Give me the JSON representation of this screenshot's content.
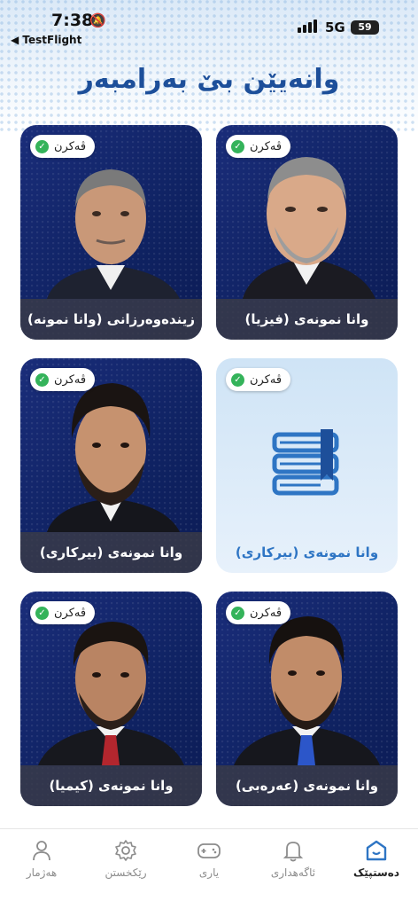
{
  "status_bar": {
    "time": "7:38",
    "back_label": "◀ TestFlight",
    "network": "5G",
    "battery": "59"
  },
  "page": {
    "title": "وانەیێن بێ بەرامبەر"
  },
  "cards": [
    {
      "badge": "ڤەکرن",
      "caption": "وانا نمونەی (فیزیا)",
      "style": "photo"
    },
    {
      "badge": "ڤەکرن",
      "caption": "زیندەوەرزانی (وانا نمونە)",
      "style": "photo"
    },
    {
      "badge": "ڤەکرن",
      "caption": "وانا نمونەی (بیرکاری)",
      "style": "book"
    },
    {
      "badge": "ڤەکرن",
      "caption": "وانا نمونەی (بیرکاری)",
      "style": "photo"
    },
    {
      "badge": "ڤەکرن",
      "caption": "وانا نمونەی (عەرەبی)",
      "style": "photo"
    },
    {
      "badge": "ڤەکرن",
      "caption": "وانا نمونەی (کیمیا)",
      "style": "photo"
    }
  ],
  "tabbar": {
    "items": [
      {
        "label": "دەستپێک",
        "icon": "home-icon",
        "active": true
      },
      {
        "label": "ئاگەهداری",
        "icon": "bell-icon",
        "active": false
      },
      {
        "label": "یاری",
        "icon": "gamepad-icon",
        "active": false
      },
      {
        "label": "رێکخستن",
        "icon": "gear-icon",
        "active": false
      },
      {
        "label": "هەژمار",
        "icon": "user-icon",
        "active": false
      }
    ]
  },
  "colors": {
    "accent": "#1d4f9a",
    "badge_check": "#34b35a",
    "card_dark": "#13276c"
  }
}
